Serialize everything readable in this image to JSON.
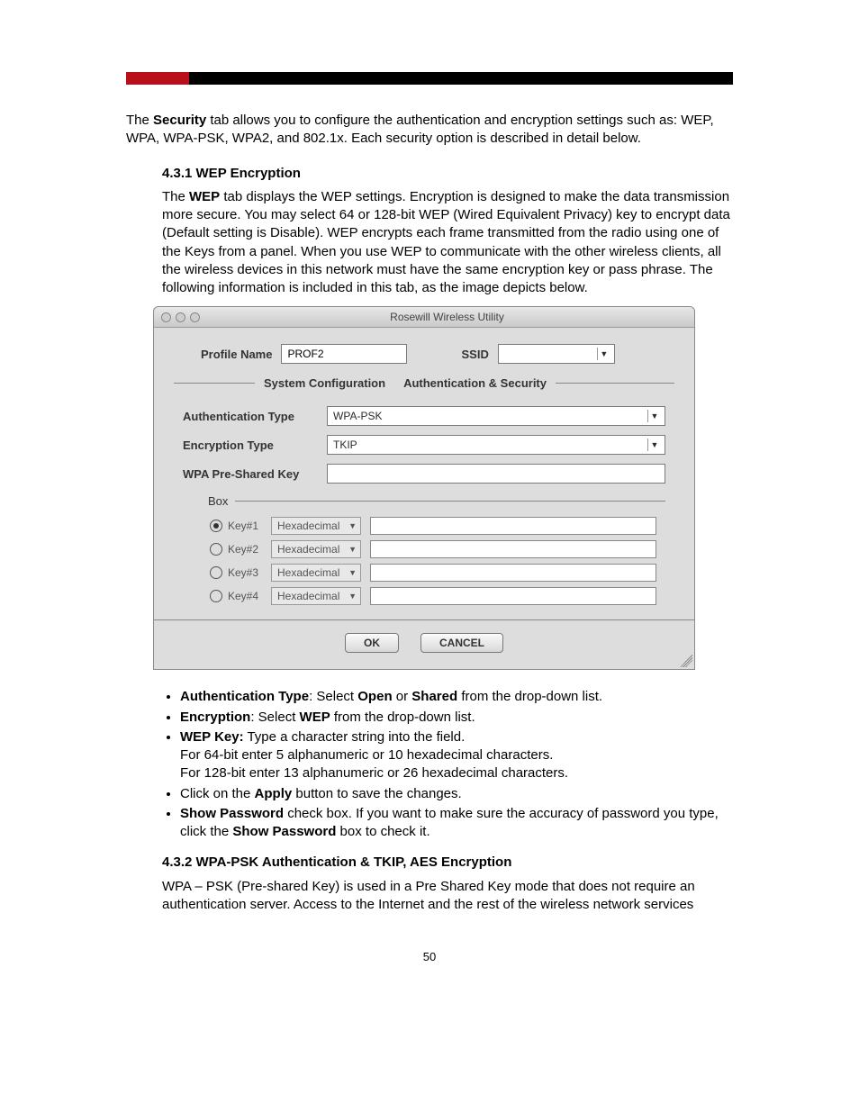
{
  "intro": {
    "p1_a": "The ",
    "p1_b": "Security",
    "p1_c": " tab allows you to configure the authentication and encryption settings such as: WEP, WPA, WPA-PSK, WPA2, and 802.1x. Each security option is described in detail below."
  },
  "sec431": {
    "heading": "4.3.1 WEP Encryption",
    "p_a": "The ",
    "p_b": "WEP",
    "p_c": " tab displays the WEP settings. Encryption is designed to make the data transmission more secure. You may select 64 or 128-bit WEP (Wired Equivalent Privacy) key to encrypt data (Default setting is Disable). WEP encrypts each frame transmitted from the radio using one of the Keys from a panel. When you use WEP to communicate with the other wireless clients, all the wireless devices in this network must have the same encryption key or pass phrase.  The following information is included in this tab, as the image depicts below."
  },
  "app": {
    "windowTitle": "Rosewill Wireless Utility",
    "profileNameLabel": "Profile Name",
    "profileNameValue": "PROF2",
    "ssidLabel": "SSID",
    "ssidValue": "",
    "tabs": {
      "sysconfig": "System Configuration",
      "authsec": "Authentication & Security"
    },
    "authTypeLabel": "Authentication Type",
    "authTypeValue": "WPA-PSK",
    "encTypeLabel": "Encryption Type",
    "encTypeValue": "TKIP",
    "pskLabel": "WPA Pre-Shared Key",
    "pskValue": "",
    "boxLabel": "Box",
    "keys": [
      {
        "label": "Key#1",
        "format": "Hexadecimal",
        "selected": true,
        "value": ""
      },
      {
        "label": "Key#2",
        "format": "Hexadecimal",
        "selected": false,
        "value": ""
      },
      {
        "label": "Key#3",
        "format": "Hexadecimal",
        "selected": false,
        "value": ""
      },
      {
        "label": "Key#4",
        "format": "Hexadecimal",
        "selected": false,
        "value": ""
      }
    ],
    "okLabel": "OK",
    "cancelLabel": "CANCEL"
  },
  "bullets": {
    "b1_a": "Authentication Type",
    "b1_b": ": Select ",
    "b1_c": "Open",
    "b1_d": " or ",
    "b1_e": "Shared",
    "b1_f": " from the drop-down list.",
    "b2_a": "Encryption",
    "b2_b": ": Select ",
    "b2_c": "WEP",
    "b2_d": " from the drop-down list.",
    "b3_a": "WEP Key:",
    "b3_b": " Type a character string into the field.",
    "b3_c": "For 64-bit enter 5 alphanumeric or 10 hexadecimal characters.",
    "b3_d": "For 128-bit enter 13 alphanumeric or 26 hexadecimal characters.",
    "b4_a": "Click on the ",
    "b4_b": "Apply",
    "b4_c": " button to save the changes.",
    "b5_a": "Show Password",
    "b5_b": " check box. If you want to make sure the accuracy of password you type, click the ",
    "b5_c": "Show Password",
    "b5_d": " box to check it."
  },
  "sec432": {
    "heading": "4.3.2 WPA-PSK Authentication & TKIP, AES Encryption",
    "p": "WPA – PSK (Pre-shared Key) is used in a Pre Shared Key mode that does not require an authentication server.  Access to the Internet and the rest of the wireless network services"
  },
  "pageNumber": "50"
}
